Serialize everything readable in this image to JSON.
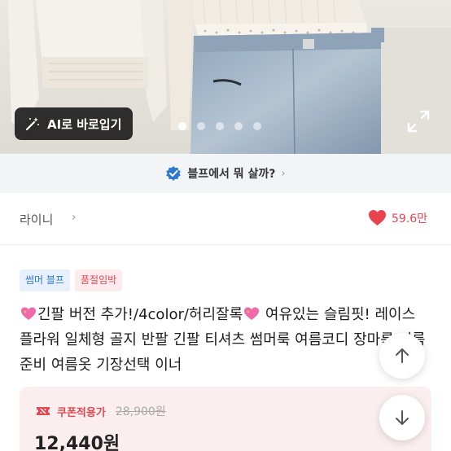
{
  "hero": {
    "ai_button_label": "AI로 바로입기",
    "ai_button_icon": "magic-wand-icon",
    "expand_icon": "expand-icon",
    "dots_count": 5,
    "active_dot": 1
  },
  "banner": {
    "icon": "verified-check-icon",
    "text": "블프에서 뭐 살까?",
    "chevron": "›"
  },
  "seller": {
    "name": "라이니",
    "chevron": "›",
    "likes": "59.6만",
    "heart_icon": "heart-icon"
  },
  "badges": [
    {
      "label": "썸머 블프",
      "style": "blue"
    },
    {
      "label": "품절임박",
      "style": "pink"
    }
  ],
  "title": {
    "part1": "긴팔 버전 추가!/4color/허리잘록",
    "part2": " 여유있는 슬림핏! 레이스 플라워 일체형 골지 반팔 긴팔 티셔츠 썸머룩 여름코디 장마룩 여름준비 여름옷 기장선택 이너"
  },
  "price": {
    "coupon_label": "쿠폰적용가",
    "original_price": "28,900원",
    "final_price": "12,440원"
  },
  "colors": {
    "accent_red": "#e8434e",
    "badge_blue": "#2f78d0",
    "badge_pink": "#e24a53",
    "price_card_bg": "#fbeeee"
  },
  "fabs": {
    "up_icon": "arrow-up-icon",
    "down_icon": "arrow-down-icon"
  }
}
